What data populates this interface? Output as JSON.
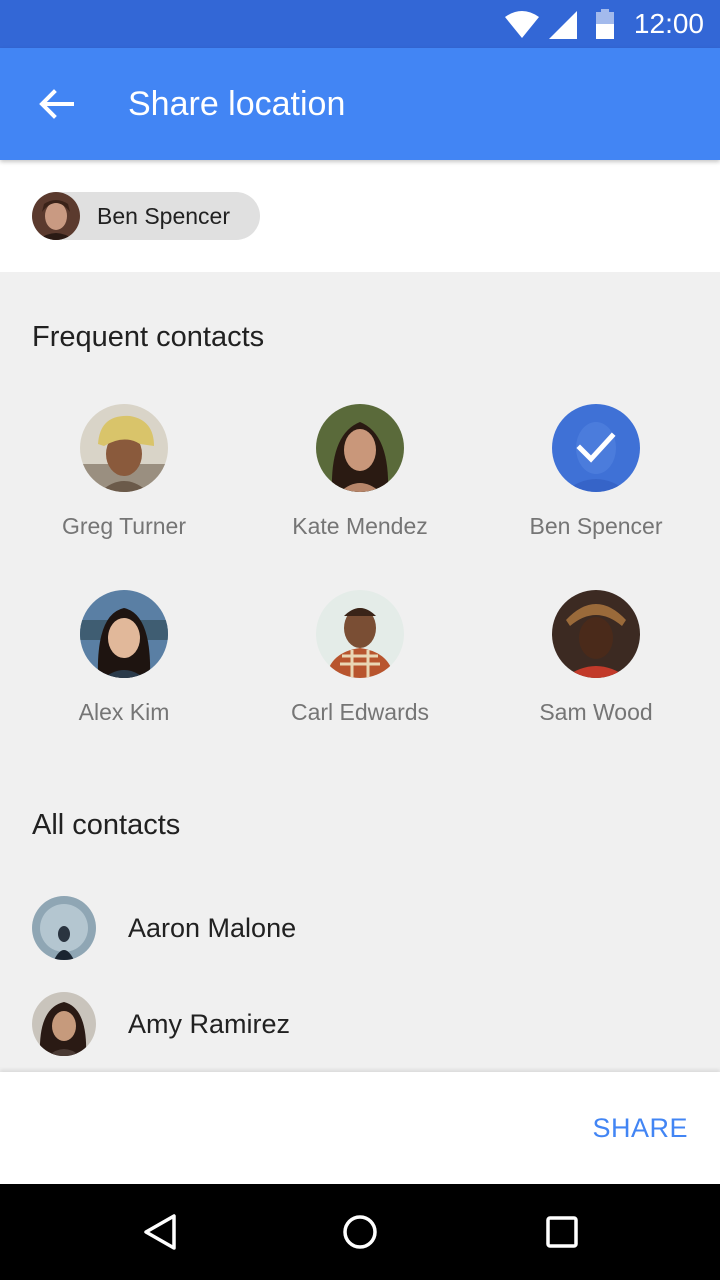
{
  "status_bar": {
    "time": "12:00",
    "icons": [
      "wifi-icon",
      "cellular-signal-icon",
      "battery-icon"
    ]
  },
  "app_bar": {
    "title": "Share location",
    "back_icon": "arrow-back-icon"
  },
  "selected_chips": [
    {
      "name": "Ben Spencer"
    }
  ],
  "frequent_contacts": {
    "heading": "Frequent contacts",
    "items": [
      {
        "name": "Greg Turner",
        "selected": false
      },
      {
        "name": "Kate Mendez",
        "selected": false
      },
      {
        "name": "Ben Spencer",
        "selected": true
      },
      {
        "name": "Alex Kim",
        "selected": false
      },
      {
        "name": "Carl Edwards",
        "selected": false
      },
      {
        "name": "Sam Wood",
        "selected": false
      }
    ]
  },
  "all_contacts": {
    "heading": "All contacts",
    "items": [
      {
        "name": "Aaron Malone"
      },
      {
        "name": "Amy Ramirez"
      }
    ]
  },
  "actions": {
    "share_label": "SHARE"
  },
  "nav_bar": {
    "icons": [
      "back-triangle-icon",
      "home-circle-icon",
      "recents-square-icon"
    ]
  },
  "colors": {
    "status_bar": "#3367d6",
    "app_bar": "#4285f4",
    "accent": "#4285f4",
    "background": "#f0f0f0"
  }
}
